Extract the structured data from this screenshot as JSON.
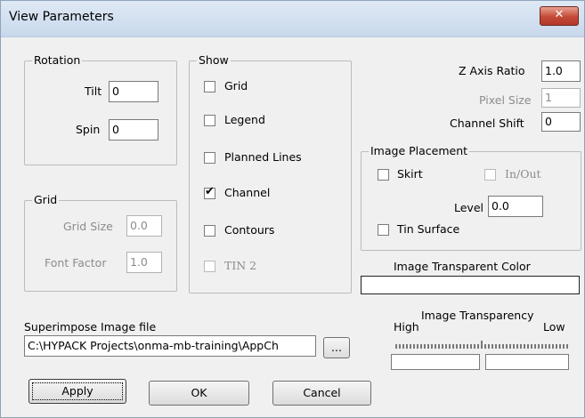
{
  "window": {
    "title": "View Parameters",
    "close_icon": "close-icon"
  },
  "rotation": {
    "legend": "Rotation",
    "tilt_label": "Tilt",
    "tilt_value": "0",
    "spin_label": "Spin",
    "spin_value": "0"
  },
  "grid": {
    "legend": "Grid",
    "size_label": "Grid Size",
    "size_value": "0.0",
    "font_label": "Font Factor",
    "font_value": "1.0"
  },
  "show": {
    "legend": "Show",
    "items": [
      {
        "label": "Grid",
        "checked": false,
        "enabled": true
      },
      {
        "label": "Legend",
        "checked": false,
        "enabled": true
      },
      {
        "label": "Planned Lines",
        "checked": false,
        "enabled": true
      },
      {
        "label": "Channel",
        "checked": true,
        "enabled": true
      },
      {
        "label": "Contours",
        "checked": false,
        "enabled": true
      },
      {
        "label": "TIN 2",
        "checked": false,
        "enabled": false
      }
    ]
  },
  "params": {
    "z_axis_label": "Z Axis Ratio",
    "z_axis_value": "1.0",
    "pixel_label": "Pixel Size",
    "pixel_value": "1",
    "channel_label": "Channel Shift",
    "channel_value": "0"
  },
  "placement": {
    "legend": "Image Placement",
    "skirt_label": "Skirt",
    "inout_label": "In/Out",
    "level_label": "Level",
    "level_value": "0.0",
    "tin_label": "Tin Surface"
  },
  "transparent": {
    "color_label": "Image Transparent Color",
    "transparency_label": "Image Transparency",
    "high": "High",
    "low": "Low"
  },
  "superimpose": {
    "label": "Superimpose Image file",
    "path": "C:\\HYPACK Projects\\onma-mb-training\\AppCh",
    "browse": "..."
  },
  "buttons": {
    "apply": "Apply",
    "ok": "OK",
    "cancel": "Cancel"
  }
}
